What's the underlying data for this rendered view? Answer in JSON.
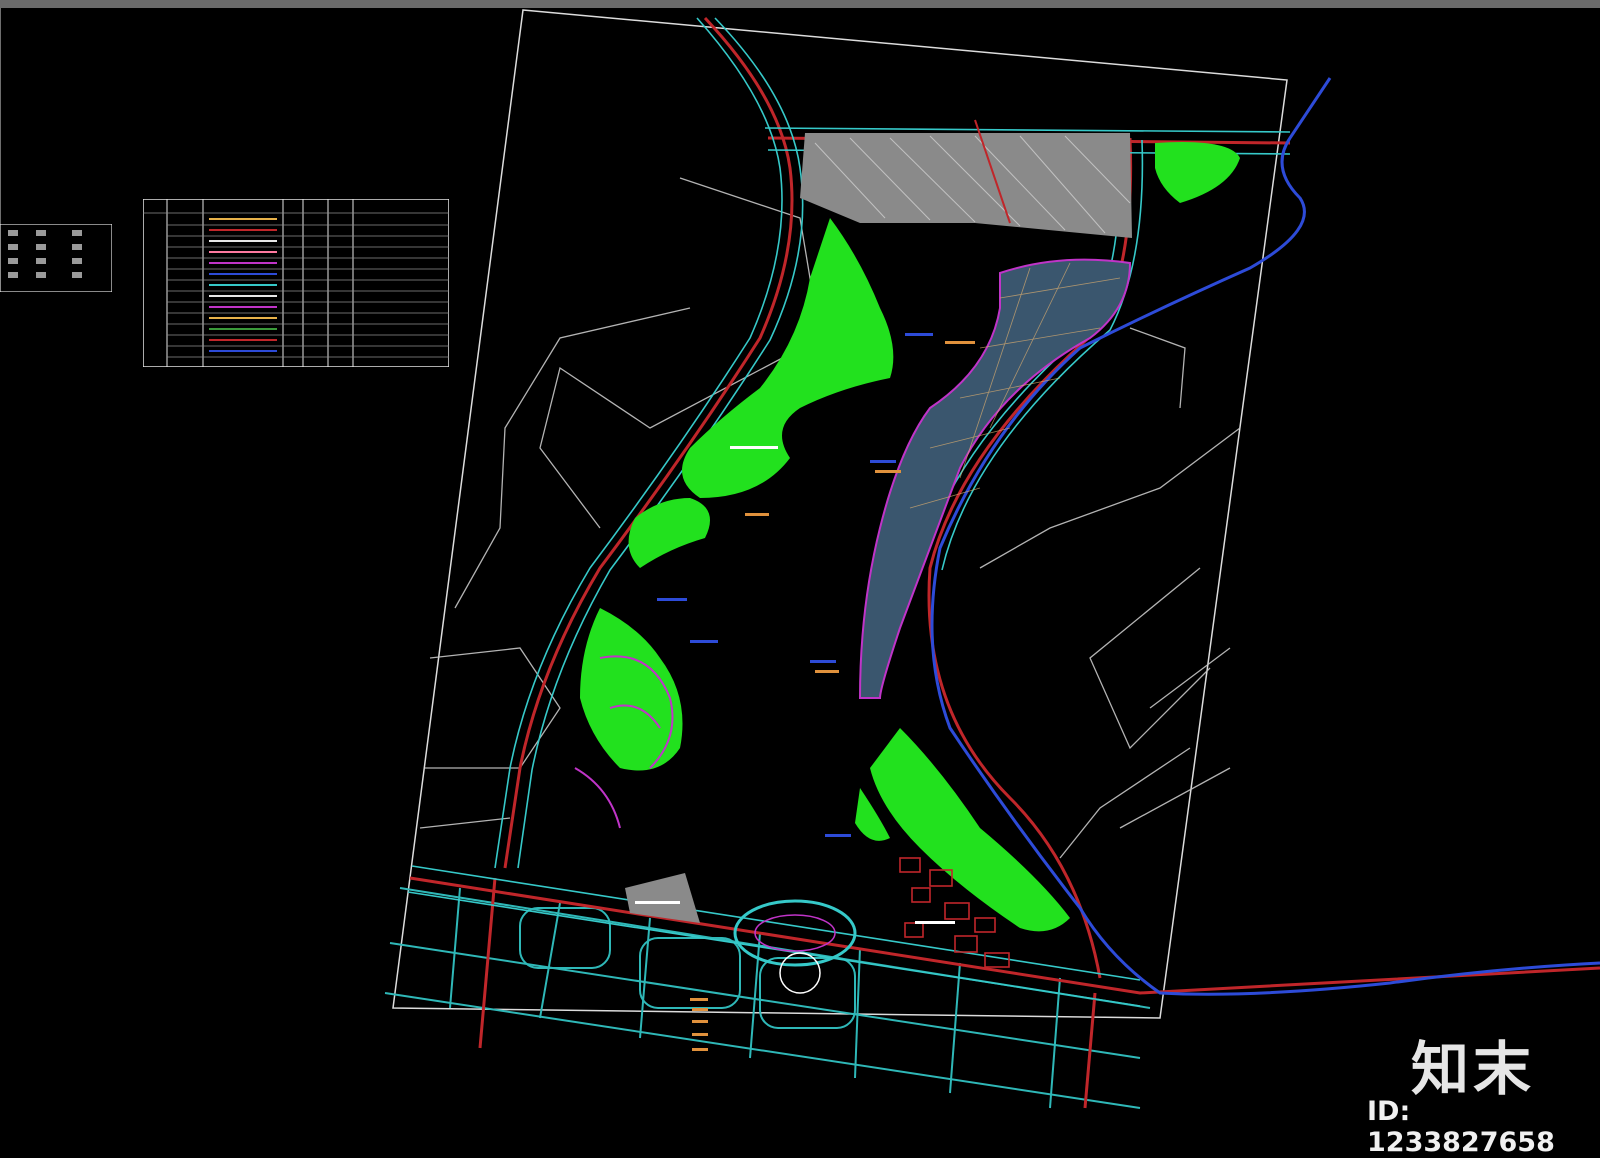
{
  "brand": {
    "logo_text": "知末",
    "id_text": "ID: 1233827658"
  },
  "colors": {
    "background": "#000000",
    "park_green": "#22e11e",
    "road_red": "#c0262a",
    "road_cyan": "#33c6c6",
    "water_blue": "#2d4bd8",
    "hatch_gray": "#8a8a8a",
    "grid_slate": "#3a566e",
    "path_magenta": "#c034c8"
  },
  "icons": [
    "drawing-canvas",
    "legend-table",
    "site-boundary"
  ]
}
